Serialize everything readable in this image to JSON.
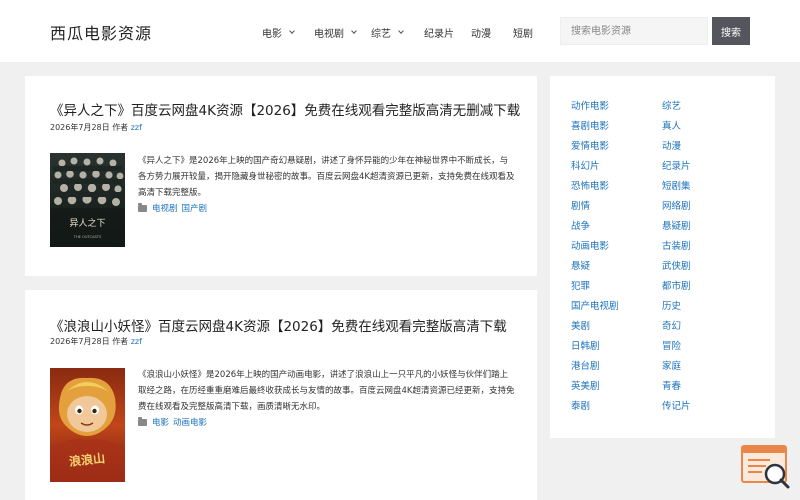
{
  "header": {
    "site_title": "西瓜电影资源",
    "nav": [
      {
        "label": "电影",
        "has_dropdown": true
      },
      {
        "label": "电视剧",
        "has_dropdown": true
      },
      {
        "label": "综艺",
        "has_dropdown": true
      },
      {
        "label": "纪录片",
        "has_dropdown": false
      },
      {
        "label": "动漫",
        "has_dropdown": false
      },
      {
        "label": "短剧",
        "has_dropdown": false
      }
    ],
    "search": {
      "placeholder": "搜索电影资源",
      "button_label": "搜索"
    }
  },
  "posts": [
    {
      "title": "《异人之下》百度云网盘4K资源【2026】免费在线观看完整版高清无删减下载",
      "date": "2026年7月28日",
      "by": "作者",
      "author": "zzf",
      "excerpt": "《异人之下》是2026年上映的国产奇幻悬疑剧，讲述了身怀异能的少年在神秘世界中不断成长，与各方势力展开较量，揭开隐藏身世秘密的故事。百度云网盘4K超清资源已更新，支持免费在线观看及高清下载完整版。",
      "categories": [
        "电视剧",
        "国产剧"
      ],
      "poster_caption": "异人之下",
      "poster_sub": "THE OUTCASTS"
    },
    {
      "title": "《浪浪山小妖怪》百度云网盘4K资源【2026】免费在线观看完整版高清下载",
      "date": "2026年7月28日",
      "by": "作者",
      "author": "zzf",
      "excerpt": "《浪浪山小妖怪》是2026年上映的国产动画电影，讲述了浪浪山上一只平凡的小妖怪与伙伴们踏上取经之路，在历经重重磨难后最终收获成长与友情的故事。百度云网盘4K超清资源已经更新，支持免费在线观看及完整版高清下载，画质清晰无水印。",
      "categories": [
        "电影",
        "动画电影"
      ],
      "poster_caption": "浪浪山"
    }
  ],
  "sidebar": {
    "tags_left": [
      "动作电影",
      "喜剧电影",
      "爱情电影",
      "科幻片",
      "恐怖电影",
      "剧情",
      "战争",
      "动画电影",
      "悬疑",
      "犯罪",
      "国产电视剧",
      "美剧",
      "日韩剧",
      "港台剧",
      "英美剧",
      "泰剧"
    ],
    "tags_right": [
      "综艺",
      "真人",
      "动漫",
      "纪录片",
      "短剧集",
      "网络剧",
      "悬疑剧",
      "古装剧",
      "武侠剧",
      "都市剧",
      "历史",
      "奇幻",
      "冒险",
      "家庭",
      "青春",
      "传记片"
    ]
  },
  "colors": {
    "link": "#1e73be",
    "search_button": "#55555e",
    "background": "#f0f0f0",
    "float_icon": "#e9864a"
  },
  "icons": {
    "post_category": "folder-icon",
    "float_widget": "chat-search-icon"
  }
}
